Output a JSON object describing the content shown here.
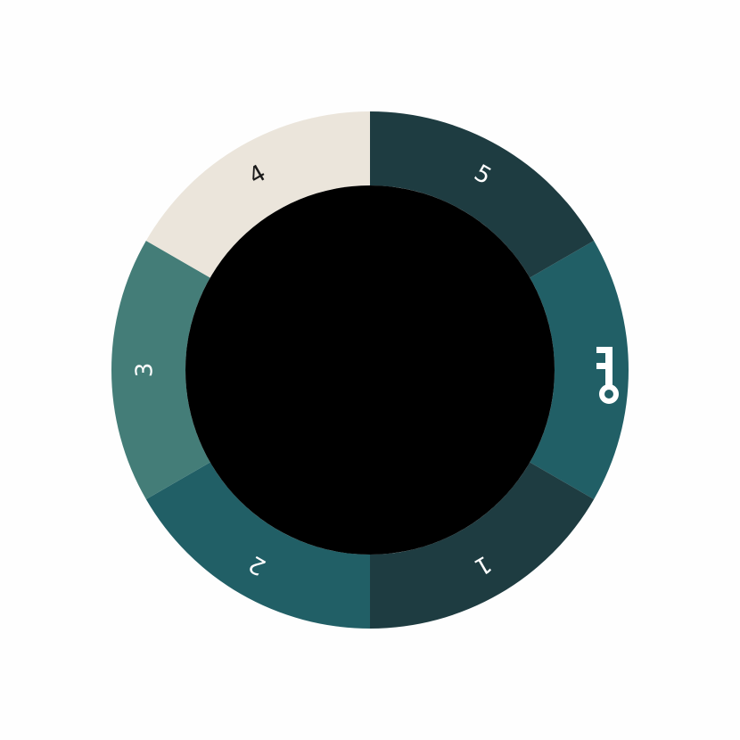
{
  "dial": {
    "segments": [
      {
        "id": "seg-key",
        "label": "",
        "icon": "key-icon",
        "color": "#215f66",
        "label_color": "#ffffff"
      },
      {
        "id": "seg-1",
        "label": "1",
        "icon": null,
        "color": "#1e3c41",
        "label_color": "#ffffff"
      },
      {
        "id": "seg-2",
        "label": "2",
        "icon": null,
        "color": "#215f66",
        "label_color": "#ffffff"
      },
      {
        "id": "seg-3",
        "label": "3",
        "icon": null,
        "color": "#447d78",
        "label_color": "#ffffff"
      },
      {
        "id": "seg-4",
        "label": "4",
        "icon": null,
        "color": "#ebe5db",
        "label_color": "#1a1a1a"
      },
      {
        "id": "seg-5",
        "label": "5",
        "icon": null,
        "color": "#1e3c41",
        "label_color": "#ffffff"
      }
    ],
    "center_color": "#000000",
    "background": "#fefefe"
  }
}
